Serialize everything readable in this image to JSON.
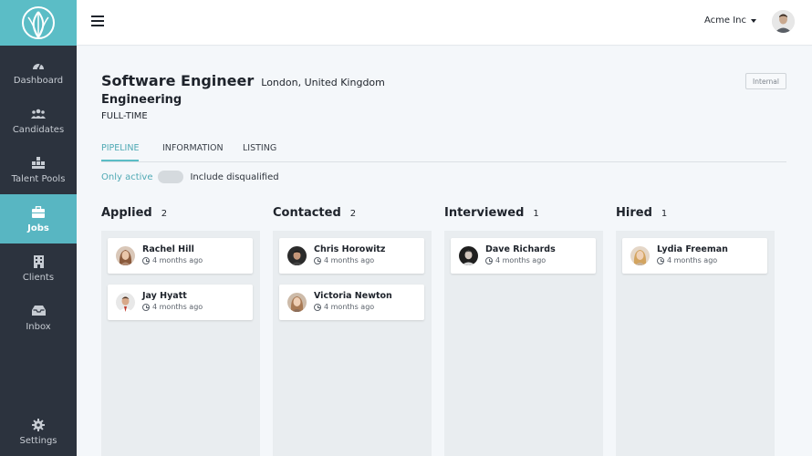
{
  "sidebar": {
    "items": [
      {
        "label": "Dashboard",
        "icon": "dashboard-icon"
      },
      {
        "label": "Candidates",
        "icon": "candidates-icon"
      },
      {
        "label": "Talent Pools",
        "icon": "talent-pools-icon"
      },
      {
        "label": "Jobs",
        "icon": "briefcase-icon",
        "active": true
      },
      {
        "label": "Clients",
        "icon": "clients-icon"
      },
      {
        "label": "Inbox",
        "icon": "inbox-icon"
      },
      {
        "label": "Settings",
        "icon": "gear-icon"
      }
    ]
  },
  "topbar": {
    "org": "Acme Inc"
  },
  "job": {
    "title": "Software Engineer",
    "location": "London, United Kingdom",
    "department": "Engineering",
    "employment": "FULL-TIME",
    "badge": "Internal"
  },
  "tabs": [
    "PIPELINE",
    "INFORMATION",
    "LISTING"
  ],
  "filter": {
    "only_active": "Only active",
    "include_disqualified": "Include disqualified"
  },
  "columns": [
    {
      "name": "Applied",
      "count": "2",
      "cards": [
        {
          "name": "Rachel Hill",
          "time": "4 months ago"
        },
        {
          "name": "Jay Hyatt",
          "time": "4 months ago"
        }
      ]
    },
    {
      "name": "Contacted",
      "count": "2",
      "cards": [
        {
          "name": "Chris Horowitz",
          "time": "4 months ago"
        },
        {
          "name": "Victoria Newton",
          "time": "4 months ago"
        }
      ]
    },
    {
      "name": "Interviewed",
      "count": "1",
      "cards": [
        {
          "name": "Dave Richards",
          "time": "4 months ago"
        }
      ]
    },
    {
      "name": "Hired",
      "count": "1",
      "cards": [
        {
          "name": "Lydia Freeman",
          "time": "4 months ago"
        }
      ]
    }
  ],
  "colors": {
    "accent": "#5bbdc6",
    "sidebar": "#2c333e",
    "active_nav": "#58b6c2"
  }
}
